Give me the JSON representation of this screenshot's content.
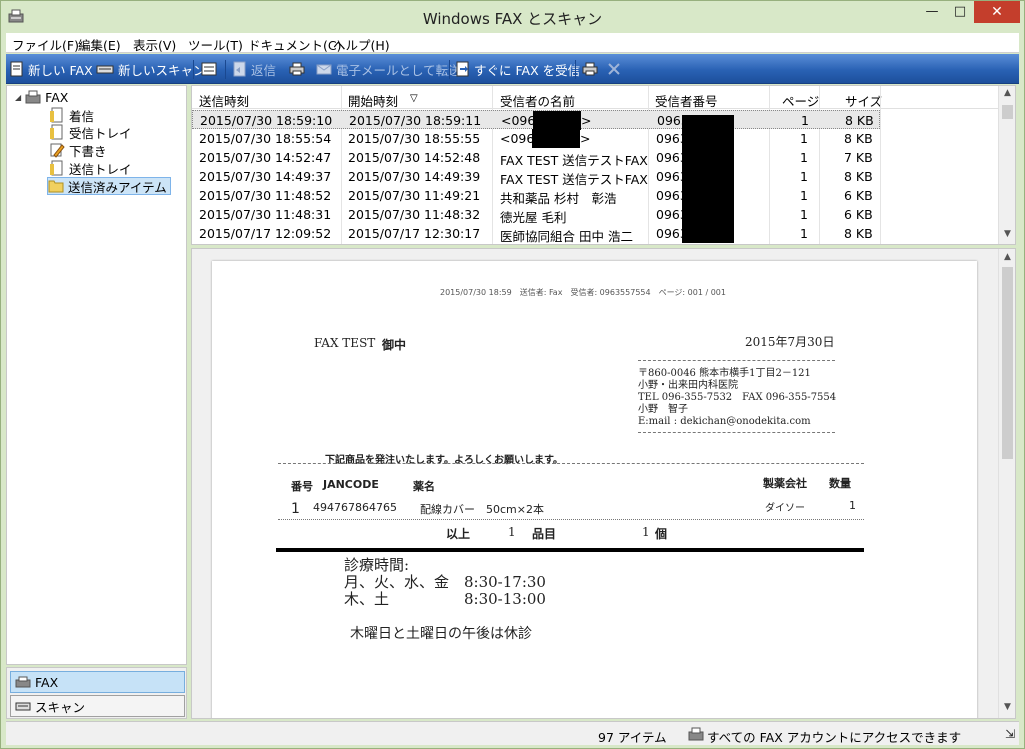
{
  "window": {
    "title": "Windows FAX とスキャン",
    "minimize": "—",
    "maximize": "□",
    "close": "✕"
  },
  "menu": [
    "ファイル(F)",
    "編集(E)",
    "表示(V)",
    "ツール(T)",
    "ドキュメント(C)",
    "ヘルプ(H)"
  ],
  "toolbar": {
    "new_fax": "新しい FAX",
    "new_scan": "新しいスキャン",
    "reply": "返信",
    "forward_email": "電子メールとして転送",
    "receive_now": "すぐに FAX を受信"
  },
  "tree": {
    "root": "FAX",
    "items": [
      "着信",
      "受信トレイ",
      "下書き",
      "送信トレイ",
      "送信済みアイテム"
    ]
  },
  "nav": {
    "fax": "FAX",
    "scan": "スキャン"
  },
  "list": {
    "columns": [
      "送信時刻",
      "開始時刻",
      "受信者の名前",
      "受信者番号",
      "ページ",
      "サイズ"
    ],
    "sort_indicator": "▽",
    "rows": [
      {
        "sent": "2015/07/30 18:59:10",
        "start": "2015/07/30 18:59:11",
        "name": "<096",
        "name_end": ">",
        "number": "0963",
        "pages": "1",
        "size": "8 KB"
      },
      {
        "sent": "2015/07/30 18:55:54",
        "start": "2015/07/30 18:55:55",
        "name": "<096",
        "name_end": ">",
        "number": "0963",
        "pages": "1",
        "size": "8 KB"
      },
      {
        "sent": "2015/07/30 14:52:47",
        "start": "2015/07/30 14:52:48",
        "name": "FAX TEST 送信テストFAX",
        "name_end": "",
        "number": "0963",
        "pages": "1",
        "size": "7 KB"
      },
      {
        "sent": "2015/07/30 14:49:37",
        "start": "2015/07/30 14:49:39",
        "name": "FAX TEST 送信テストFAX",
        "name_end": "",
        "number": "0963",
        "pages": "1",
        "size": "8 KB"
      },
      {
        "sent": "2015/07/30 11:48:52",
        "start": "2015/07/30 11:49:21",
        "name": "共和薬品 杉村　彰浩",
        "name_end": "",
        "number": "0963",
        "pages": "1",
        "size": "6 KB"
      },
      {
        "sent": "2015/07/30 11:48:31",
        "start": "2015/07/30 11:48:32",
        "name": "徳光屋 毛利",
        "name_end": "",
        "number": "0963",
        "pages": "1",
        "size": "6 KB"
      },
      {
        "sent": "2015/07/17 12:09:52",
        "start": "2015/07/17 12:30:17",
        "name": "医師協同組合 田中 浩二",
        "name_end": "",
        "number": "0963",
        "pages": "1",
        "size": "8 KB"
      }
    ]
  },
  "fax": {
    "header_line": "2015/07/30 18:59　送信者: Fax　受信者: 0963557554　ページ: 001 / 001",
    "to_name": "FAX TEST",
    "to_suffix": "御中",
    "date": "2015年7月30日",
    "sender": [
      "〒860-0046 熊本市横手1丁目2－121",
      "小野・出来田内科医院",
      "TEL 096-355-7532　FAX 096-355-7554",
      "小野　智子",
      "E:mail : dekichan@onodekita.com"
    ],
    "intro": "下記商品を発注いたします。よろしくお願いします。",
    "table_headers": {
      "no": "番号",
      "jan": "JANCODE",
      "item": "薬名",
      "maker": "製薬会社",
      "qty": "数量"
    },
    "order": {
      "no": "1",
      "jan": "494767864765",
      "item": "配線カバー　50cm×2本",
      "maker": "ダイソー",
      "qty": "1"
    },
    "summary": {
      "label": "以上",
      "items": "1",
      "items_unit": "品目",
      "count": "1",
      "count_unit": "個"
    },
    "hours": [
      "診療時間:",
      "月、火、水、金　8:30-17:30",
      "木、土　　　　　8:30-13:00"
    ],
    "closed": "木曜日と土曜日の午後は休診"
  },
  "status": {
    "count": "97 アイテム",
    "account": "すべての FAX アカウントにアクセスできます"
  }
}
